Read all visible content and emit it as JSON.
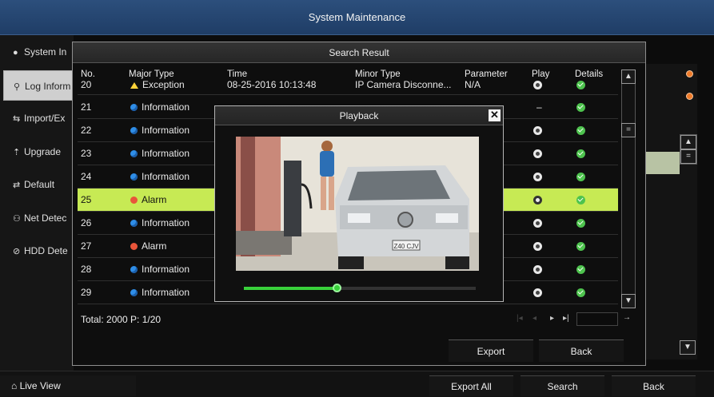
{
  "window": {
    "title": "System Maintenance"
  },
  "sidebar": {
    "items": [
      {
        "label": "System In",
        "icon": "info-icon"
      },
      {
        "label": "Log Inform",
        "icon": "search-icon",
        "active": true
      },
      {
        "label": "Import/Ex",
        "icon": "import-export-icon"
      },
      {
        "label": "Upgrade",
        "icon": "upload-icon"
      },
      {
        "label": "Default",
        "icon": "reset-icon"
      },
      {
        "label": "Net Detec",
        "icon": "network-icon"
      },
      {
        "label": "HDD Dete",
        "icon": "disk-icon"
      }
    ]
  },
  "bottom_bar": {
    "live_view": "Live View",
    "export_all": "Export All",
    "search": "Search",
    "back": "Back"
  },
  "dialog": {
    "title": "Search Result",
    "columns": {
      "no": "No.",
      "major": "Major Type",
      "time": "Time",
      "minor": "Minor Type",
      "parameter": "Parameter",
      "play": "Play",
      "details": "Details"
    },
    "rows": [
      {
        "no": "20",
        "type": "Exception",
        "kind": "exception",
        "time": "08-25-2016 10:13:48",
        "minor": "IP Camera Disconne...",
        "parameter": "N/A",
        "play": "play"
      },
      {
        "no": "21",
        "type": "Information",
        "kind": "info",
        "play": "none"
      },
      {
        "no": "22",
        "type": "Information",
        "kind": "info",
        "play": "play"
      },
      {
        "no": "23",
        "type": "Information",
        "kind": "info",
        "play": "play"
      },
      {
        "no": "24",
        "type": "Information",
        "kind": "info",
        "play": "play"
      },
      {
        "no": "25",
        "type": "Alarm",
        "kind": "alarm",
        "play": "play",
        "selected": true
      },
      {
        "no": "26",
        "type": "Information",
        "kind": "info",
        "play": "play"
      },
      {
        "no": "27",
        "type": "Alarm",
        "kind": "alarm",
        "play": "play"
      },
      {
        "no": "28",
        "type": "Information",
        "kind": "info",
        "play": "play"
      },
      {
        "no": "29",
        "type": "Information",
        "kind": "info",
        "play": "play"
      }
    ],
    "none_marker": "–",
    "footer": {
      "total": "Total: 2000  P: 1/20"
    },
    "export_button": "Export",
    "back_button": "Back"
  },
  "playback": {
    "title": "Playback",
    "close": "✕",
    "progress": 0.4,
    "plate": "Z40 CJV"
  },
  "colors": {
    "header": "#2c4f7c",
    "selected_row": "#c7ea54",
    "info_dot": "#2f8ee8",
    "alarm_dot": "#e8553a",
    "details_icon": "#4ec34e",
    "progress": "#39d13b"
  }
}
